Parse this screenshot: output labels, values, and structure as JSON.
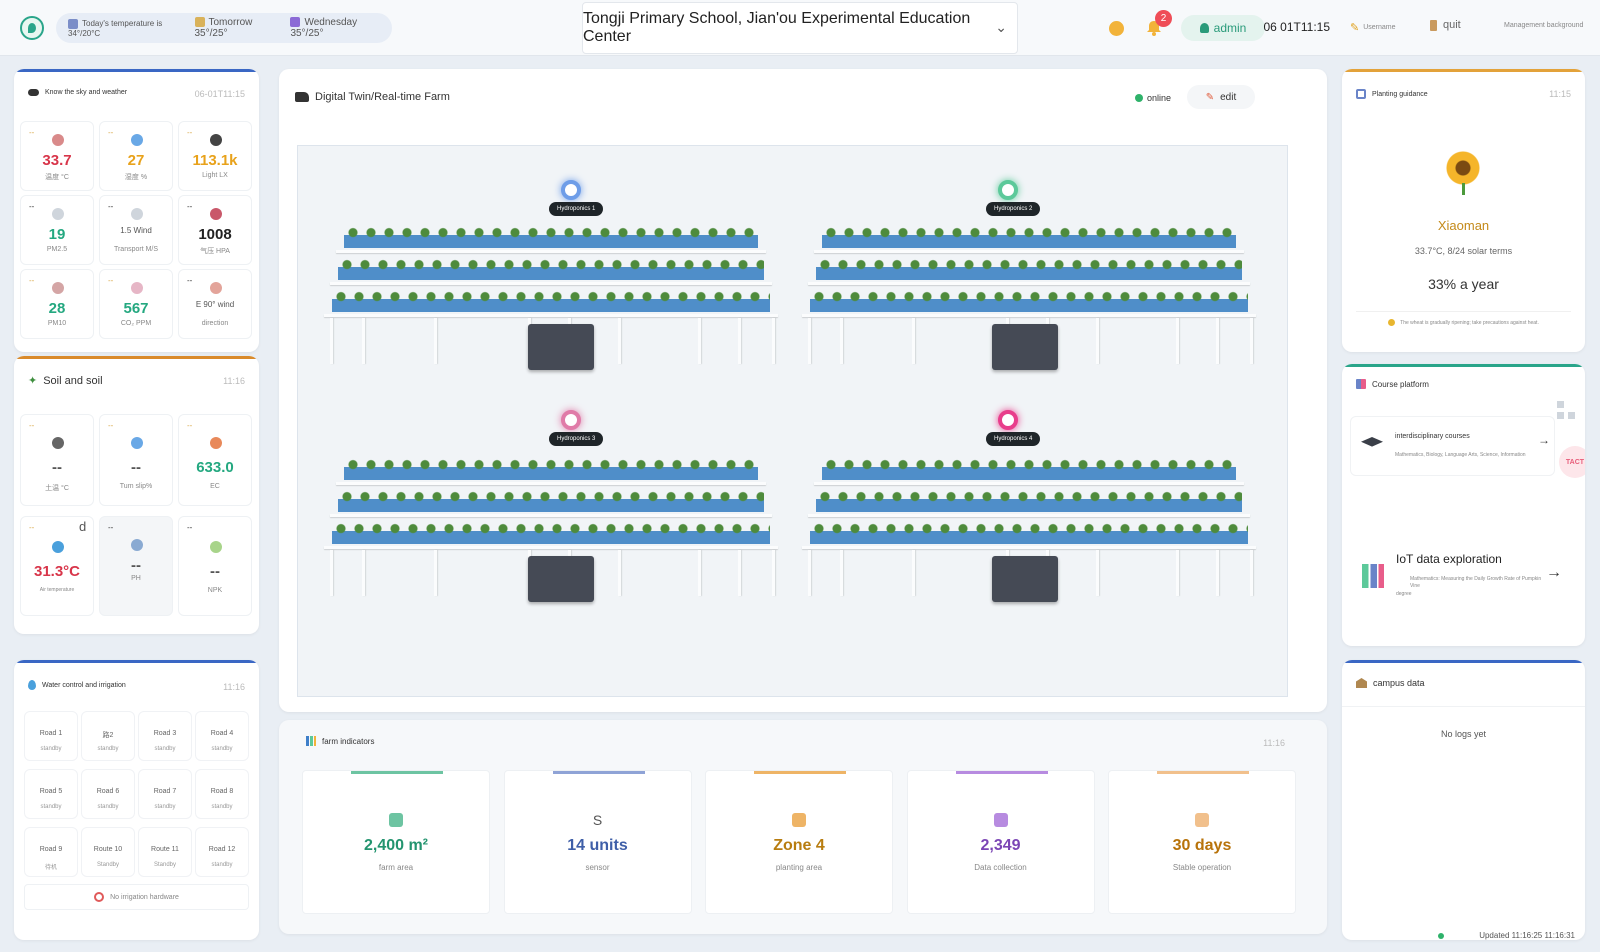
{
  "header": {
    "weather_today": "Today's temperature is 34°/20°C",
    "weather_tomorrow": "Tomorrow 35°/25°",
    "weather_wednesday": "Wednesday 35°/25°",
    "school": "Tongji Primary School, Jian'ou Experimental Education Center",
    "notifications": "2",
    "user": "admin",
    "clock": "06 01T11:15",
    "key_label": "Username",
    "quit": "quit",
    "management": "Management background"
  },
  "sky": {
    "title": "Know the sky and weather",
    "time": "06-01T11:15",
    "tiles": [
      {
        "value": "33.7",
        "label": "温度 °C",
        "color": "#d8354a"
      },
      {
        "value": "27",
        "label": "湿度 %",
        "color": "#e8a21b"
      },
      {
        "value": "113.1k",
        "label": "Light LX",
        "color": "#e8a21b"
      },
      {
        "value": "19",
        "label": "PM2.5",
        "color": "#24a880"
      },
      {
        "value": "1.5 Wind",
        "label": "Transport M/S",
        "color": "#555"
      },
      {
        "value": "1008",
        "label": "气压 HPA",
        "color": "#222"
      },
      {
        "value": "28",
        "label": "PM10",
        "color": "#24a880"
      },
      {
        "value": "567",
        "label": "CO₂ PPM",
        "color": "#24a880"
      },
      {
        "value": "E 90° wind",
        "label": "direction",
        "color": "#555"
      }
    ]
  },
  "soil": {
    "title": "Soil and soil",
    "time": "11:16",
    "tiles": [
      {
        "value": "--",
        "label": "土温 °C",
        "color": "#555"
      },
      {
        "value": "--",
        "label": "Tum slip%",
        "color": "#555"
      },
      {
        "value": "633.0",
        "label": "EC",
        "color": "#24a880"
      },
      {
        "value": "31.3°C",
        "label": "Air temperature",
        "color": "#d8354a"
      },
      {
        "value": "--",
        "label": "PH",
        "color": "#555"
      },
      {
        "value": "--",
        "label": "NPK",
        "color": "#555"
      }
    ],
    "d_mark": "d"
  },
  "water": {
    "title": "Water control and irrigation",
    "time": "11:16",
    "roads": [
      {
        "name": "Road 1",
        "status": "standby"
      },
      {
        "name": "路2",
        "status": "standby"
      },
      {
        "name": "Road 3",
        "status": "standby"
      },
      {
        "name": "Road 4",
        "status": "standby"
      },
      {
        "name": "Road 5",
        "status": "standby"
      },
      {
        "name": "Road 6",
        "status": "standby"
      },
      {
        "name": "Road 7",
        "status": "standby"
      },
      {
        "name": "Road 8",
        "status": "standby"
      },
      {
        "name": "Road 9",
        "status": "待机"
      },
      {
        "name": "Route 10",
        "status": "Standby"
      },
      {
        "name": "Route 11",
        "status": "Standby"
      },
      {
        "name": "Road 12",
        "status": "standby"
      }
    ],
    "footer": "No irrigation hardware"
  },
  "farm": {
    "title": "Digital Twin/Real-time Farm",
    "status": "online",
    "edit": "edit",
    "labels": [
      "Hydroponics 1",
      "Hydroponics 2",
      "Hydroponics 3",
      "Hydroponics 4"
    ],
    "marker_colors": [
      "#6e9de8",
      "#5cc99a",
      "#e07ba8",
      "#e83d8b"
    ]
  },
  "indicators": {
    "title": "farm indicators",
    "time": "11:16",
    "items": [
      {
        "icon_text": "",
        "value": "2,400 m²",
        "label": "farm area",
        "color": "#23946f",
        "bar": "#6dc4a2"
      },
      {
        "icon_text": "S",
        "value": "14 units",
        "label": "sensor",
        "color": "#3f5fa8",
        "bar": "#8fa3d6"
      },
      {
        "icon_text": "",
        "value": "Zone 4",
        "label": "planting area",
        "color": "#b87d10",
        "bar": "#eeb466"
      },
      {
        "icon_text": "",
        "value": "2,349",
        "label": "Data collection",
        "color": "#7b45b5",
        "bar": "#b78be0"
      },
      {
        "icon_text": "",
        "value": "30 days",
        "label": "Stable operation",
        "color": "#b8730a",
        "bar": "#f1c08c"
      }
    ]
  },
  "guidance": {
    "title": "Planting guidance",
    "time": "11:15",
    "term": "Xiaoman",
    "detail": "33.7°C, 8/24 solar terms",
    "progress": "33% a year",
    "tip": "The wheat is gradually ripening; take precautions against heat."
  },
  "courses": {
    "title": "Course platform",
    "c1_title": "interdisciplinary courses",
    "c1_desc": "Mathematics, Biology, Language Arts, Science, Information",
    "c2_title": "IoT data exploration",
    "c2_desc": "Mathematics: Measuring the Daily Growth Rate of Pumpkin Vine",
    "c2_desc2": "degree",
    "chip": "TACT"
  },
  "campus": {
    "title": "campus data",
    "empty": "No logs yet",
    "updated": "Updated 11:16:25 11:16:31"
  }
}
